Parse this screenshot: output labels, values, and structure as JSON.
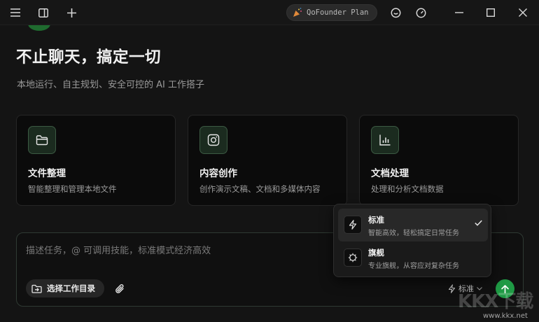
{
  "titlebar": {
    "plan_badge": "QoFounder Plan",
    "icons": [
      "menu-icon",
      "sidebar-toggle-icon",
      "new-chat-icon",
      "party-icon",
      "chat-bubble-icon",
      "speedometer-icon",
      "minimize-icon",
      "maximize-icon",
      "close-icon"
    ]
  },
  "hero": {
    "title": "不止聊天，搞定一切",
    "subtitle": "本地运行、自主规划、安全可控的 AI 工作搭子"
  },
  "cards": [
    {
      "title": "文件整理",
      "desc": "智能整理和管理本地文件",
      "icon": "folder-icon"
    },
    {
      "title": "内容创作",
      "desc": "创作演示文稿、文档和多媒体内容",
      "icon": "camera-icon"
    },
    {
      "title": "文档处理",
      "desc": "处理和分析文档数据",
      "icon": "bar-chart-icon"
    }
  ],
  "composer": {
    "placeholder": "描述任务，@ 可调用技能，标准模式经济高效",
    "dir_button": "选择工作目录",
    "mode": "标准"
  },
  "mode_menu": {
    "items": [
      {
        "title": "标准",
        "desc": "智能高效，轻松搞定日常任务",
        "selected": true,
        "icon": "lightning-icon"
      },
      {
        "title": "旗舰",
        "desc": "专业旗舰，从容应对复杂任务",
        "selected": false,
        "icon": "chip-icon"
      }
    ]
  },
  "watermark": {
    "logo": "KKX下载",
    "url": "www.kkx.net"
  },
  "colors": {
    "background": "#141414",
    "accent": "#1f9a45",
    "card_border": "#262626",
    "icon_bg": "#1b2b1f"
  }
}
